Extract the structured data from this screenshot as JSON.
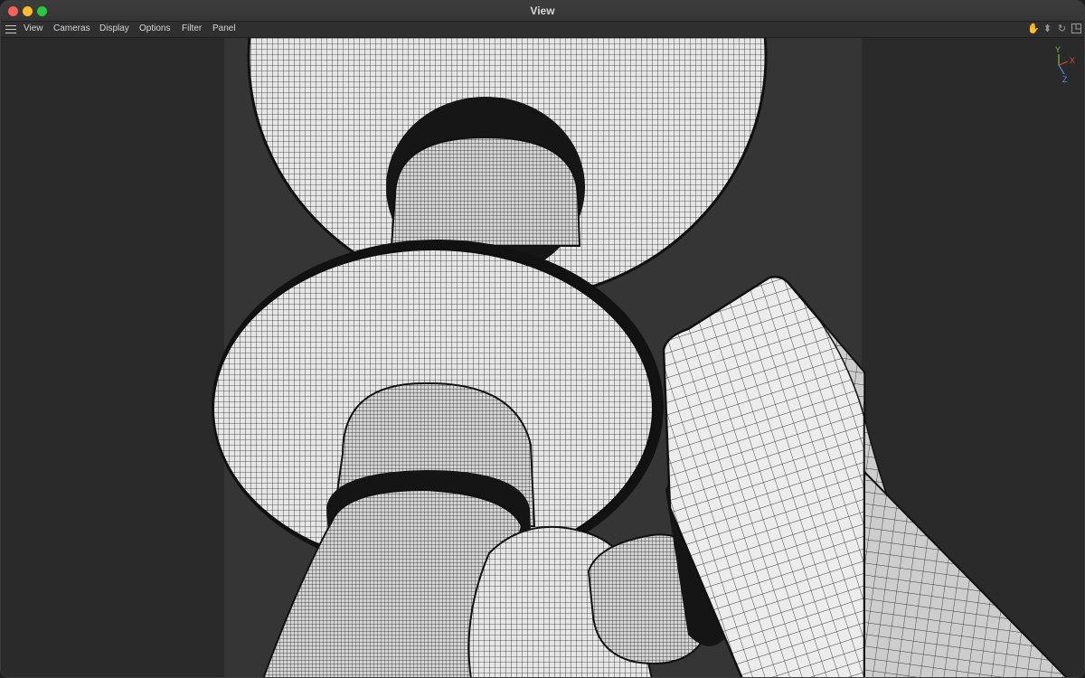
{
  "window": {
    "title": "View"
  },
  "menu": [
    "View",
    "Cameras",
    "Display",
    "Options",
    "Filter",
    "Panel"
  ],
  "toolbar_icons": [
    "hand-pan-icon",
    "move-arrow-icon",
    "rotate-icon",
    "maximize-view-icon"
  ],
  "axis_gizmo": {
    "y": "Y",
    "x": "X",
    "z": "Z"
  },
  "colors": {
    "y_axis": "#6fc23f",
    "x_axis": "#e0463a",
    "z_axis": "#4f8cf0"
  }
}
